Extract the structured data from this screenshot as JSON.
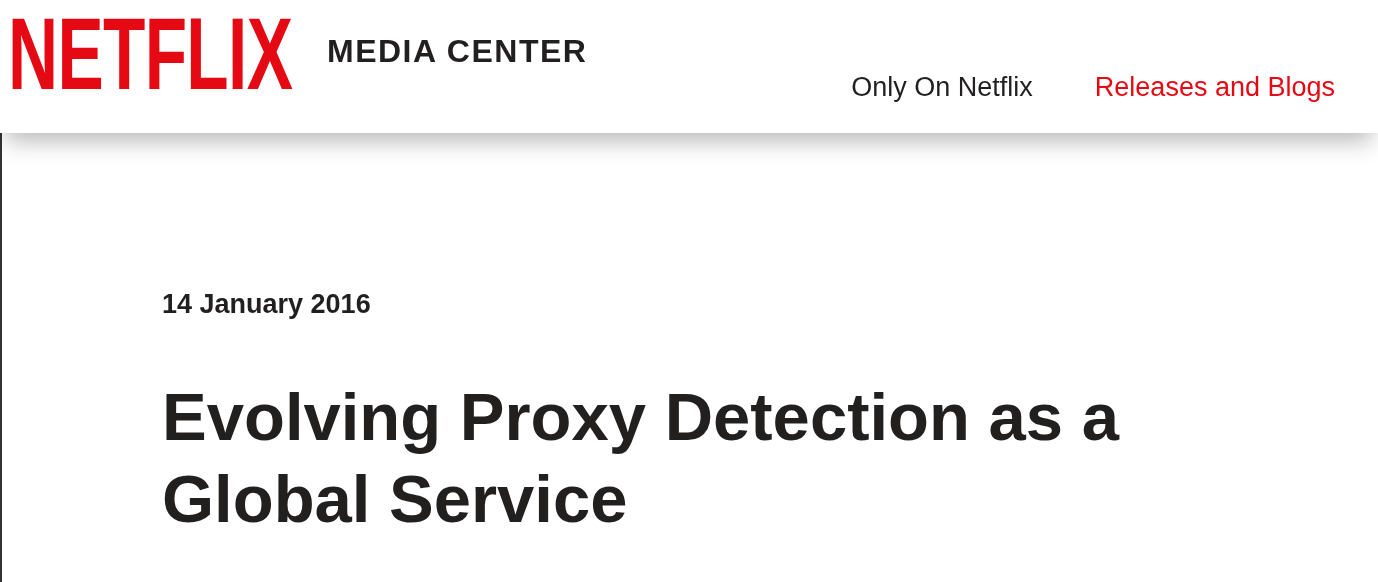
{
  "header": {
    "logo": "NETFLIX",
    "subtitle": "MEDIA CENTER",
    "nav": [
      {
        "label": "Only On Netflix",
        "selected": false
      },
      {
        "label": "Releases and Blogs",
        "selected": true
      }
    ]
  },
  "article": {
    "date": "14 January 2016",
    "title": "Evolving Proxy Detection as a Global Service"
  }
}
